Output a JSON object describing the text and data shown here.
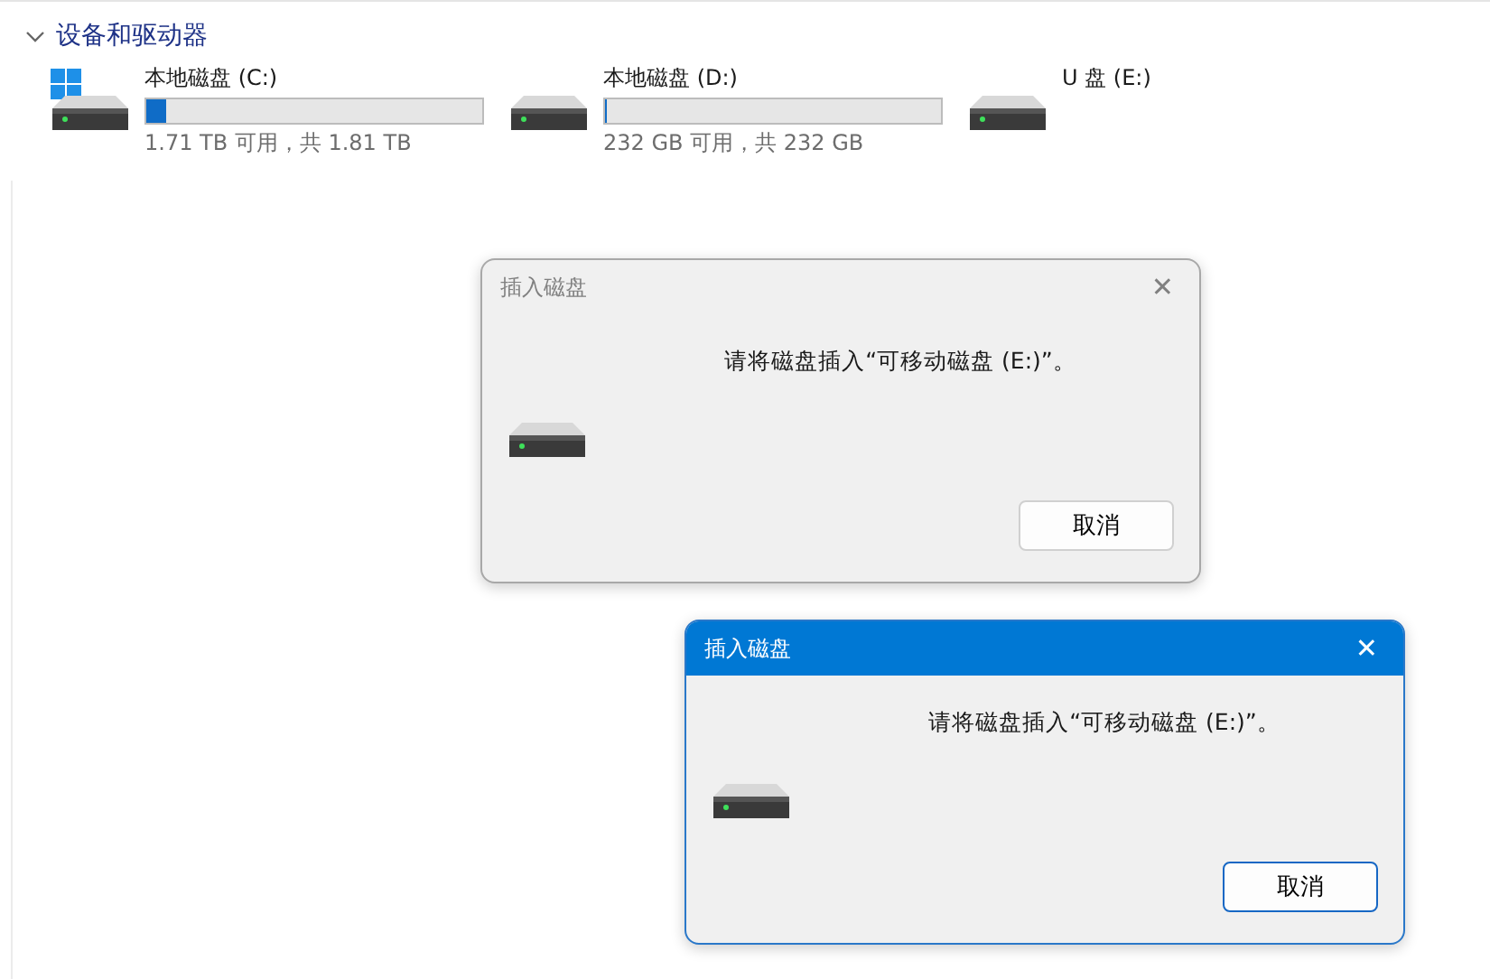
{
  "section": {
    "title": "设备和驱动器",
    "expanded": true
  },
  "drives": [
    {
      "name": "本地磁盘 (C:)",
      "kind": "bar",
      "system": true,
      "level": 0.06,
      "info": "1.71 TB 可用，共 1.81 TB"
    },
    {
      "name": "本地磁盘 (D:)",
      "kind": "bar",
      "system": false,
      "level": 0.005,
      "info": "232 GB 可用，共 232 GB"
    },
    {
      "name": "U 盘 (E:)",
      "kind": "plain",
      "system": false
    }
  ],
  "dialogs": [
    {
      "title": "插入磁盘",
      "active": false,
      "message": "请将磁盘插入“可移动磁盘 (E:)”。",
      "close": "✕",
      "button": "取消"
    },
    {
      "title": "插入磁盘",
      "active": true,
      "message": "请将磁盘插入“可移动磁盘 (E:)”。",
      "close": "✕",
      "button": "取消"
    }
  ]
}
